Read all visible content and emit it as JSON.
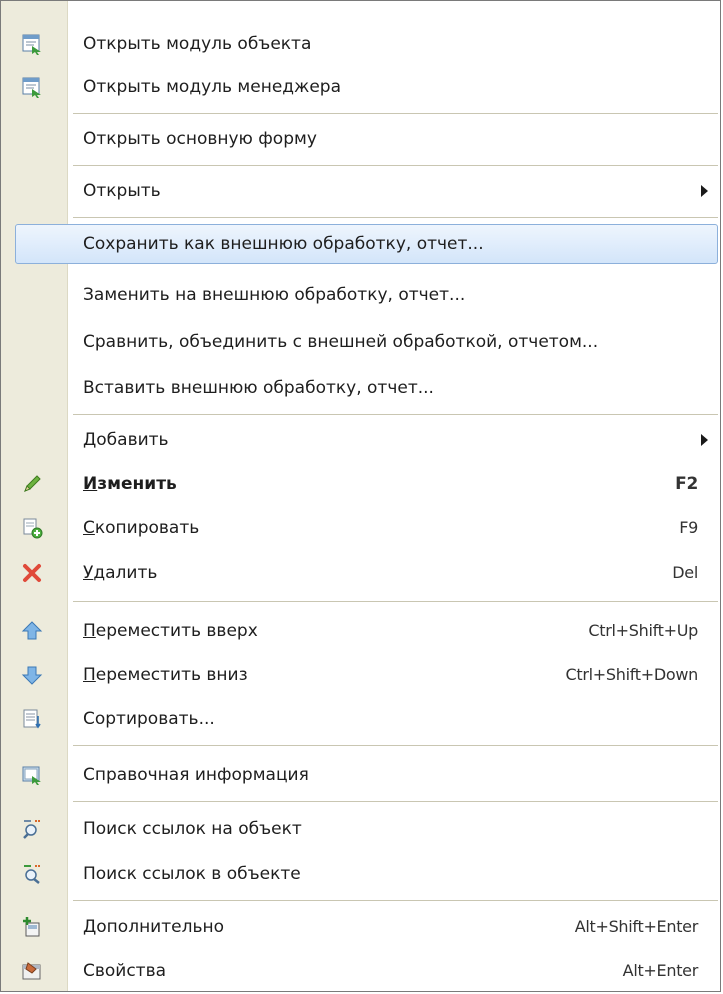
{
  "menu": {
    "items": [
      {
        "label": "Открыть модуль объекта",
        "icon": "module-object-icon"
      },
      {
        "label": "Открыть модуль менеджера",
        "icon": "module-manager-icon"
      },
      {
        "label": "Открыть основную форму"
      },
      {
        "label": "Открыть",
        "submenu": true
      },
      {
        "label": "Сохранить как внешнюю обработку, отчет...",
        "highlighted": true
      },
      {
        "label": "Заменить на внешнюю обработку, отчет..."
      },
      {
        "label": "Сравнить, объединить с внешней обработкой, отчетом..."
      },
      {
        "label": "Вставить внешнюю обработку, отчет..."
      },
      {
        "label": "Добавить",
        "submenu": true
      },
      {
        "label_first": "И",
        "label_rest": "зменить",
        "shortcut": "F2",
        "icon": "pencil-icon"
      },
      {
        "label_first": "С",
        "label_rest": "копировать",
        "shortcut": "F9",
        "icon": "copy-icon"
      },
      {
        "label_first": "У",
        "label_rest": "далить",
        "shortcut": "Del",
        "icon": "delete-icon"
      },
      {
        "label_first": "П",
        "label_rest": "ереместить вверх",
        "shortcut": "Ctrl+Shift+Up",
        "icon": "arrow-up-icon"
      },
      {
        "label_first": "П",
        "label_rest": "ереместить вниз",
        "shortcut": "Ctrl+Shift+Down",
        "icon": "arrow-down-icon"
      },
      {
        "label": "Сортировать...",
        "icon": "sort-icon"
      },
      {
        "label": "Справочная информация",
        "icon": "help-info-icon"
      },
      {
        "label": "Поиск ссылок на объект",
        "icon": "find-references-icon"
      },
      {
        "label": "Поиск ссылок в объекте",
        "icon": "find-in-object-icon"
      },
      {
        "label": "Дополнительно",
        "shortcut": "Alt+Shift+Enter",
        "icon": "additional-icon"
      },
      {
        "label": "Свойства",
        "shortcut": "Alt+Enter",
        "icon": "properties-icon"
      }
    ]
  },
  "colors": {
    "gutter": "#edebdc",
    "highlight_border": "#8cb0db",
    "highlight_fill": "#d3e5fa"
  }
}
